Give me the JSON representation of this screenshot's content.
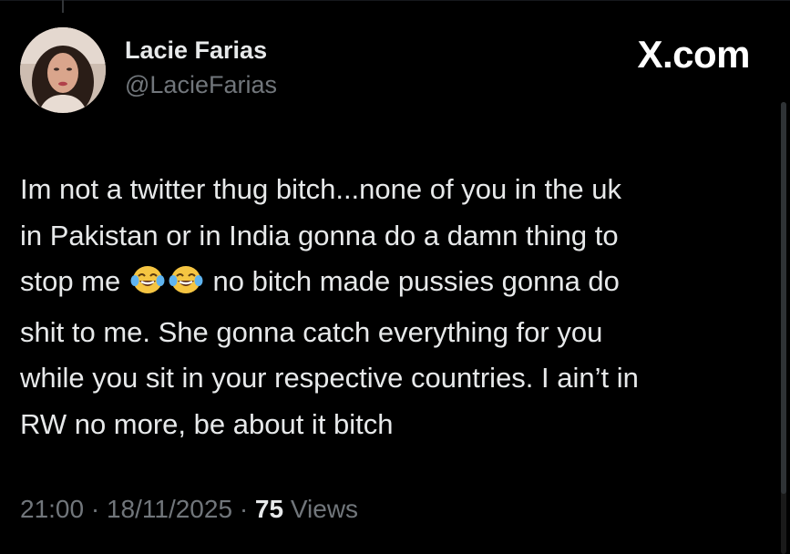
{
  "author": {
    "name": "Lacie Farias",
    "handle": "@LacieFarias",
    "avatar_icon": "profile-photo"
  },
  "brand": {
    "label": "X.com"
  },
  "tweet": {
    "lines": [
      "Im not a twitter thug bitch...none of you in the uk",
      "in Pakistan or in India gonna do a damn thing to",
      "stop me",
      "no bitch made pussies gonna do",
      "shit to me. She gonna catch everything for you",
      "while you sit in your respective countries. I ain’t in",
      "RW no more, be about it bitch"
    ],
    "emoji": [
      "😂",
      "😂"
    ]
  },
  "meta": {
    "time": "21:00",
    "separator": "·",
    "date": "18/11/2025",
    "views_count": "75",
    "views_label": "Views"
  },
  "colors": {
    "background": "#000000",
    "primary_text": "#e7e9ea",
    "secondary_text": "#71767b"
  }
}
